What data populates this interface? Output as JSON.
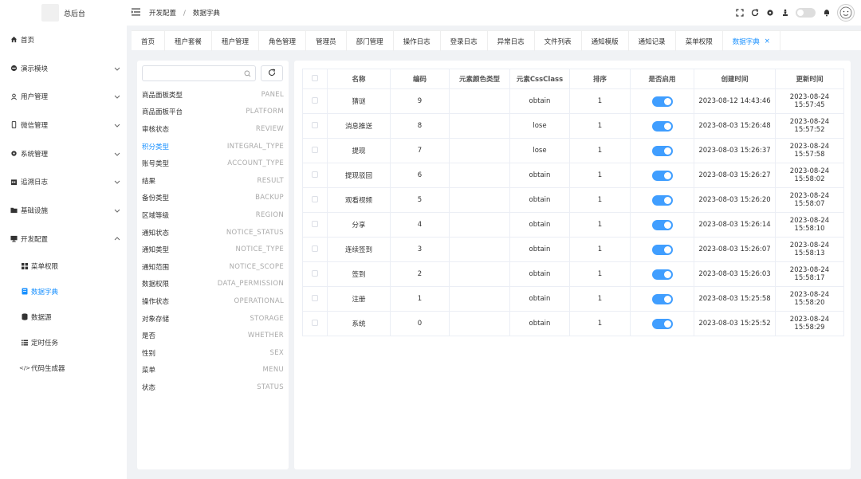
{
  "app": {
    "title": "总后台"
  },
  "sidebar": {
    "items": [
      {
        "label": "首页",
        "icon": "home-icon"
      },
      {
        "label": "演示模块",
        "icon": "circle-icon"
      },
      {
        "label": "用户管理",
        "icon": "user-icon"
      },
      {
        "label": "微信管理",
        "icon": "phone-icon"
      },
      {
        "label": "系统管理",
        "icon": "gear-icon"
      },
      {
        "label": "追溯日志",
        "icon": "calendar-icon"
      },
      {
        "label": "基础设施",
        "icon": "folder-icon"
      },
      {
        "label": "开发配置",
        "icon": "monitor-icon"
      }
    ],
    "subitems": [
      {
        "label": "菜单权限",
        "icon": "grid-icon"
      },
      {
        "label": "数据字典",
        "icon": "book-icon"
      },
      {
        "label": "数据源",
        "icon": "database-icon"
      },
      {
        "label": "定时任务",
        "icon": "list-icon"
      },
      {
        "label": "代码生成器",
        "icon": "code-icon"
      }
    ]
  },
  "header": {
    "breadcrumb": [
      "开发配置",
      "数据字典"
    ],
    "switch_label": "关"
  },
  "tabs": [
    "首页",
    "租户套餐",
    "租户管理",
    "角色管理",
    "管理员",
    "部门管理",
    "操作日志",
    "登录日志",
    "异常日志",
    "文件列表",
    "通知模版",
    "通知记录",
    "菜单权限",
    "数据字典"
  ],
  "dict": {
    "search_placeholder": "",
    "items": [
      {
        "name": "商品面板类型",
        "code": "PANEL"
      },
      {
        "name": "商品面板平台",
        "code": "PLATFORM"
      },
      {
        "name": "审核状态",
        "code": "REVIEW"
      },
      {
        "name": "积分类型",
        "code": "INTEGRAL_TYPE"
      },
      {
        "name": "账号类型",
        "code": "ACCOUNT_TYPE"
      },
      {
        "name": "结果",
        "code": "RESULT"
      },
      {
        "name": "备份类型",
        "code": "BACKUP"
      },
      {
        "name": "区域等级",
        "code": "REGION"
      },
      {
        "name": "通知状态",
        "code": "NOTICE_STATUS"
      },
      {
        "name": "通知类型",
        "code": "NOTICE_TYPE"
      },
      {
        "name": "通知范围",
        "code": "NOTICE_SCOPE"
      },
      {
        "name": "数据权限",
        "code": "DATA_PERMISSION"
      },
      {
        "name": "操作状态",
        "code": "OPERATIONAL"
      },
      {
        "name": "对象存储",
        "code": "STORAGE"
      },
      {
        "name": "是否",
        "code": "WHETHER"
      },
      {
        "name": "性别",
        "code": "SEX"
      },
      {
        "name": "菜单",
        "code": "MENU"
      },
      {
        "name": "状态",
        "code": "STATUS"
      }
    ]
  },
  "table": {
    "columns": [
      "名称",
      "编码",
      "元素颜色类型",
      "元素CssClass",
      "排序",
      "是否启用",
      "创建时间",
      "更新时间"
    ],
    "rows": [
      [
        "猜谜",
        "9",
        "",
        "obtain",
        "1",
        "2023-08-12 14:43:46",
        "2023-08-24 15:57:45"
      ],
      [
        "消息推送",
        "8",
        "",
        "lose",
        "1",
        "2023-08-03 15:26:48",
        "2023-08-24 15:57:52"
      ],
      [
        "提现",
        "7",
        "",
        "lose",
        "1",
        "2023-08-03 15:26:37",
        "2023-08-24 15:57:58"
      ],
      [
        "提现驳回",
        "6",
        "",
        "obtain",
        "1",
        "2023-08-03 15:26:27",
        "2023-08-24 15:58:02"
      ],
      [
        "观看视频",
        "5",
        "",
        "obtain",
        "1",
        "2023-08-03 15:26:20",
        "2023-08-24 15:58:07"
      ],
      [
        "分享",
        "4",
        "",
        "obtain",
        "1",
        "2023-08-03 15:26:14",
        "2023-08-24 15:58:10"
      ],
      [
        "连续签到",
        "3",
        "",
        "obtain",
        "1",
        "2023-08-03 15:26:07",
        "2023-08-24 15:58:13"
      ],
      [
        "签到",
        "2",
        "",
        "obtain",
        "1",
        "2023-08-03 15:26:03",
        "2023-08-24 15:58:17"
      ],
      [
        "注册",
        "1",
        "",
        "obtain",
        "1",
        "2023-08-03 15:25:58",
        "2023-08-24 15:58:20"
      ],
      [
        "系统",
        "0",
        "",
        "obtain",
        "1",
        "2023-08-03 15:25:52",
        "2023-08-24 15:58:29"
      ]
    ]
  },
  "colors": {
    "accent": "#1890ff",
    "switch_on": "#409eff"
  }
}
